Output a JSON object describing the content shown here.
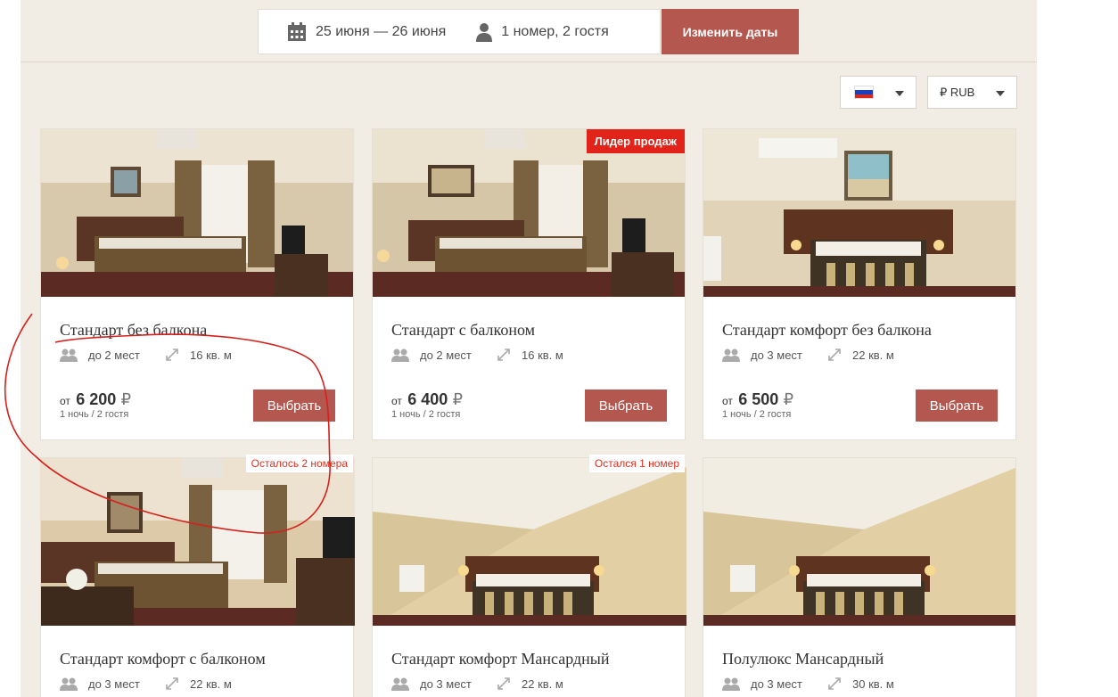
{
  "search": {
    "dates": "25 июня — 26 июня",
    "guests": "1 номер, 2 гостя",
    "change_button": "Изменить даты"
  },
  "selectors": {
    "language_flag": "russia-flag",
    "currency": "₽ RUB"
  },
  "colors": {
    "accent": "#b4574f",
    "badge_red": "#e2231a",
    "page_bg": "#f1ede5"
  },
  "rooms": [
    {
      "title": "Стандарт без балкона",
      "guests": "до 2 мест",
      "area": "16 кв. м",
      "price_from": "от",
      "price": "6 200",
      "currency": "₽",
      "per": "1 ночь / 2 гостя",
      "button": "Выбрать",
      "badge": ""
    },
    {
      "title": "Стандарт с балконом",
      "guests": "до 2 мест",
      "area": "16 кв. м",
      "price_from": "от",
      "price": "6 400",
      "currency": "₽",
      "per": "1 ночь / 2 гостя",
      "button": "Выбрать",
      "badge": "Лидер продаж"
    },
    {
      "title": "Стандарт комфорт без балкона",
      "guests": "до 3 мест",
      "area": "22 кв. м",
      "price_from": "от",
      "price": "6 500",
      "currency": "₽",
      "per": "1 ночь / 2 гостя",
      "button": "Выбрать",
      "badge": ""
    },
    {
      "title": "Стандарт комфорт с балконом",
      "guests": "до 3 мест",
      "area": "22 кв. м",
      "badge": "Осталось 2 номера"
    },
    {
      "title": "Стандарт комфорт Мансардный",
      "guests": "до 3 мест",
      "area": "22 кв. м",
      "badge": "Остался 1 номер"
    },
    {
      "title": "Полулюкс Мансардный",
      "guests": "до 3 мест",
      "area": "30 кв. м",
      "badge": ""
    }
  ]
}
